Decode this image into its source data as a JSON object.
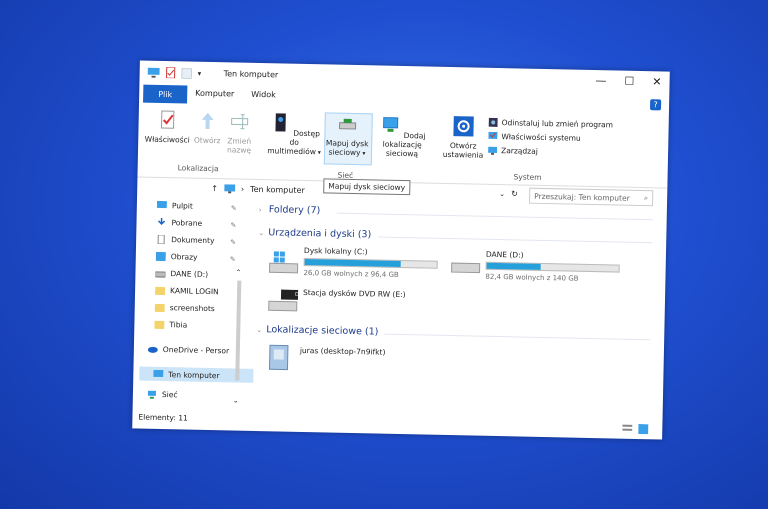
{
  "window": {
    "title": "Ten komputer",
    "controls": {
      "minimize": "—",
      "maximize": "☐",
      "close": "✕"
    }
  },
  "menu": {
    "file": "Plik",
    "tabs": [
      "Komputer",
      "Widok"
    ],
    "help": "?"
  },
  "ribbon": {
    "lokalizacja": {
      "label": "Lokalizacja",
      "buttons": [
        "Właściwości",
        "Otwórz",
        "Zmień nazwę"
      ]
    },
    "siec": {
      "label": "Sieć",
      "buttons": [
        "Dostęp do multimediów",
        "Mapuj dysk sieciowy",
        "Dodaj lokalizację sieciową"
      ]
    },
    "system": {
      "label": "System",
      "open_settings": "Otwórz ustawienia",
      "items": [
        "Odinstaluj lub zmień program",
        "Właściwości systemu",
        "Zarządzaj"
      ]
    }
  },
  "tooltip": "Mapuj dysk sieciowy",
  "address": {
    "path": "Ten komputer",
    "search_placeholder": "Przeszukaj: Ten komputer"
  },
  "nav": {
    "quick": [
      "Pulpit",
      "Pobrane",
      "Dokumenty",
      "Obrazy",
      "DANE (D:)",
      "KAMIL LOGIN",
      "screenshots",
      "Tibia"
    ],
    "onedrive": "OneDrive - Persor",
    "this_pc": "Ten komputer",
    "network": "Sieć"
  },
  "content": {
    "folders_header": "Foldery (7)",
    "devices_header": "Urządzenia i dyski (3)",
    "drives": [
      {
        "name": "Dysk lokalny (C:)",
        "free": "26,0 GB wolnych z 96,4 GB",
        "used_fraction": 0.73
      },
      {
        "name": "DANE (D:)",
        "free": "82,4 GB wolnych z 140 GB",
        "used_fraction": 0.41
      }
    ],
    "dvd": {
      "name": "Stacja dysków DVD RW (E:)",
      "label": "DVD"
    },
    "network_header": "Lokalizacje sieciowe (1)",
    "network_location": "juras (desktop-7n9ifkt)"
  },
  "status": {
    "items": "Elementy: 11"
  },
  "colors": {
    "accent": "#1a63c9",
    "bar_fill": "#26a0da",
    "selection": "#cce4f7",
    "desktop": "#1f4fd0"
  }
}
